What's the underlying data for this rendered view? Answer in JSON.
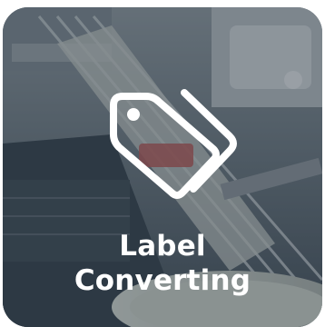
{
  "tile": {
    "title_line1": "Label",
    "title_line2": "Converting",
    "icon": "tag-icon",
    "text_color": "#ffffff",
    "overlay_color": "#2c3a46"
  }
}
